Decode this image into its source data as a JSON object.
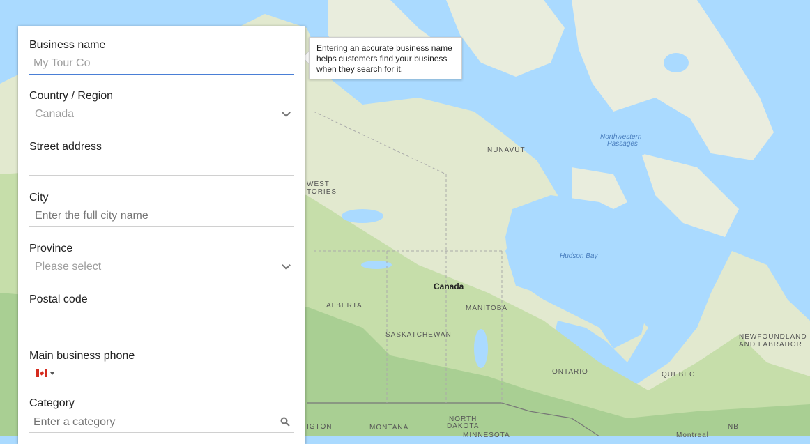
{
  "form": {
    "business_name": {
      "label": "Business name",
      "placeholder": "My Tour Co"
    },
    "country": {
      "label": "Country / Region",
      "value": "Canada"
    },
    "street": {
      "label": "Street address",
      "value": ""
    },
    "city": {
      "label": "City",
      "placeholder": "Enter the full city name"
    },
    "province": {
      "label": "Province",
      "placeholder": "Please select"
    },
    "postal": {
      "label": "Postal code",
      "value": ""
    },
    "phone": {
      "label": "Main business phone",
      "country_flag": "canada-flag",
      "value": ""
    },
    "category": {
      "label": "Category",
      "placeholder": "Enter a category",
      "icon": "search-icon"
    }
  },
  "tooltip": {
    "text": "Entering an accurate business name helps customers find your business when they search for it."
  },
  "map": {
    "labels": {
      "canada": "Canada",
      "nunavut": "NUNAVUT",
      "nw_territories_1": "WEST",
      "nw_territories_2": "TORIES",
      "alberta": "ALBERTA",
      "manitoba": "MANITOBA",
      "saskatchewan": "SASKATCHEWAN",
      "ontario": "ONTARIO",
      "quebec": "QUEBEC",
      "newfoundland_1": "NEWFOUNDLAND",
      "newfoundland_2": "AND LABRADOR",
      "nb": "NB",
      "montana": "MONTANA",
      "north_dakota_1": "NORTH",
      "north_dakota_2": "DAKOTA",
      "minnesota": "MINNESOTA",
      "washington": "IGTON",
      "hudson_bay": "Hudson Bay",
      "nw_passages_1": "Northwestern",
      "nw_passages_2": "Passages",
      "montreal": "Montreal"
    },
    "colors": {
      "water": "#aadaff",
      "land": "#e8ecdc",
      "forest": "#c8dfb0",
      "dense_forest": "#a8cf94",
      "tundra": "#eef0e6",
      "accent": "#4a7fd6"
    }
  }
}
